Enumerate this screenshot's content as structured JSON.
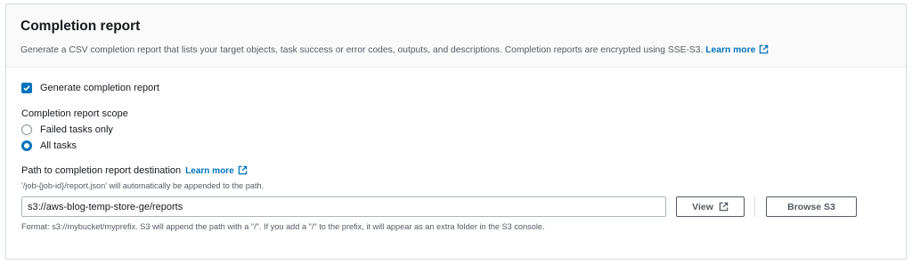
{
  "panel": {
    "title": "Completion report",
    "description": "Generate a CSV completion report that lists your target objects, task success or error codes, outputs, and descriptions. Completion reports are encrypted using SSE-S3.",
    "learn_more": "Learn more"
  },
  "generate_checkbox": {
    "label": "Generate completion report",
    "checked": true
  },
  "scope": {
    "label": "Completion report scope",
    "options": [
      {
        "label": "Failed tasks only",
        "selected": false
      },
      {
        "label": "All tasks",
        "selected": true
      }
    ]
  },
  "destination": {
    "label": "Path to completion report destination",
    "learn_more": "Learn more",
    "hint": "'/job-{job-id}/report.json' will automatically be appended to the path.",
    "value": "s3://aws-blog-temp-store-ge/reports",
    "view_label": "View",
    "browse_label": "Browse S3",
    "format_text": "Format: s3://mybucket/myprefix. S3 will append the path with a \"/\". If you add a \"/\" to the prefix, it will appear as an extra folder in the S3 console."
  },
  "colors": {
    "accent": "#0073bb",
    "text": "#16191f",
    "secondary_text": "#545b64",
    "border": "#d5dbdb"
  },
  "icons": {
    "external_link": "external-link-icon",
    "checkmark": "checkmark-icon"
  }
}
